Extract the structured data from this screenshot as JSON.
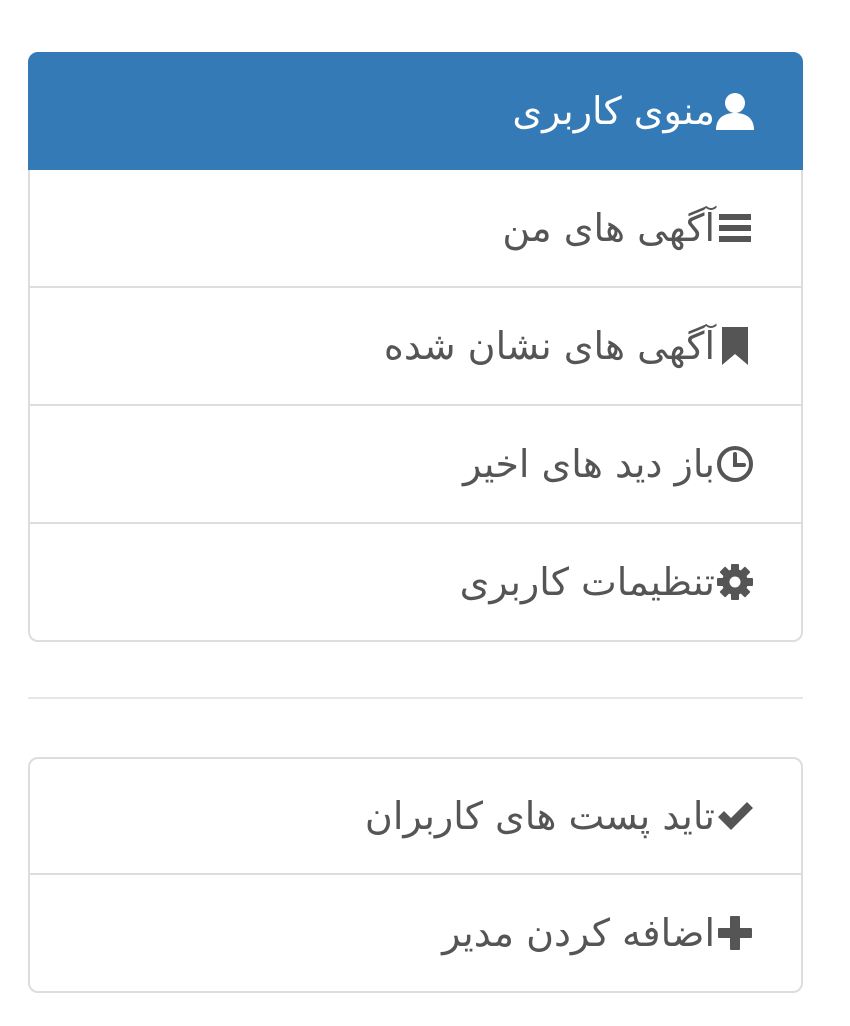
{
  "user_menu": {
    "header": {
      "label": "منوی کاربری",
      "icon": "user-icon"
    },
    "items": [
      {
        "label": "آگهی های من",
        "icon": "list-icon"
      },
      {
        "label": "آگهی های نشان شده",
        "icon": "bookmark-icon"
      },
      {
        "label": "باز دید های اخیر",
        "icon": "clock-icon"
      },
      {
        "label": "تنظیمات کاربری",
        "icon": "gear-icon"
      }
    ]
  },
  "admin_menu": {
    "items": [
      {
        "label": "تاید پست های کاربران",
        "icon": "check-icon"
      },
      {
        "label": "اضافه کردن مدیر",
        "icon": "plus-icon"
      }
    ]
  },
  "colors": {
    "header_bg": "#337ab7",
    "header_text": "#ffffff",
    "item_text": "#555555",
    "border": "#dddddd"
  }
}
